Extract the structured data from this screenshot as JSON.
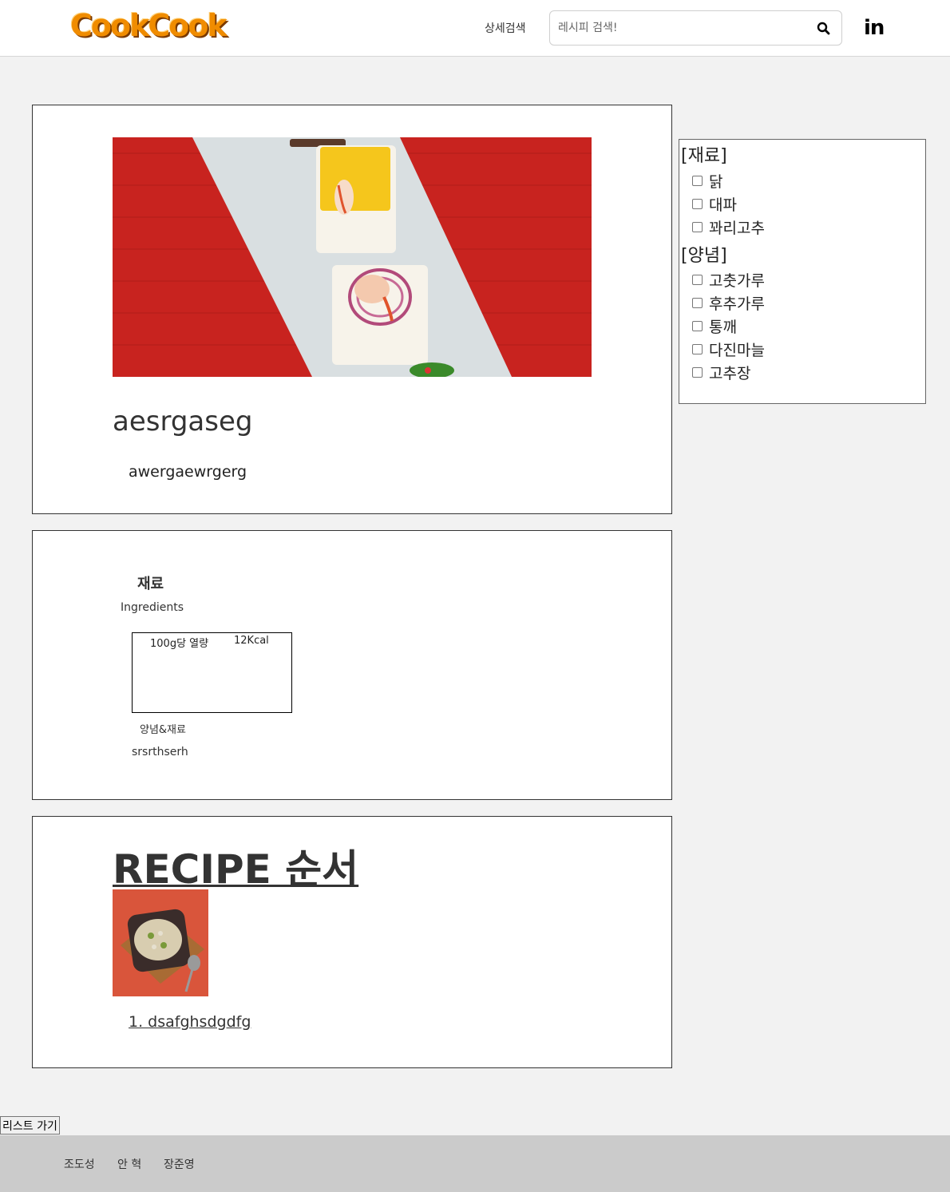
{
  "header": {
    "logo": "CookCook",
    "advanced_search": "상세검색",
    "search_placeholder": "레시피 검색!",
    "social": "in"
  },
  "recipe": {
    "title": "aesrgaseg",
    "description": "awergaewrgerg"
  },
  "ingredients": {
    "title": "재료",
    "subtitle": "Ingredients",
    "calorie_label": "100g당 열량",
    "calorie_value": "12Kcal",
    "seasoning_title": "양념&재료",
    "seasoning_text": "srsrthserh"
  },
  "steps": {
    "title": "RECIPE 순서",
    "items": [
      "1. dsafghsdgdfg"
    ]
  },
  "filter": {
    "groups": [
      {
        "title": "[재료]",
        "options": [
          "닭",
          "대파",
          "꽈리고추"
        ]
      },
      {
        "title": "[양념]",
        "options": [
          "고춧가루",
          "후추가루",
          "통깨",
          "다진마늘",
          "고추장"
        ]
      }
    ]
  },
  "list_button": "리스트 가기",
  "footer": {
    "members": [
      "조도성",
      "안 혁",
      "장준영"
    ]
  }
}
